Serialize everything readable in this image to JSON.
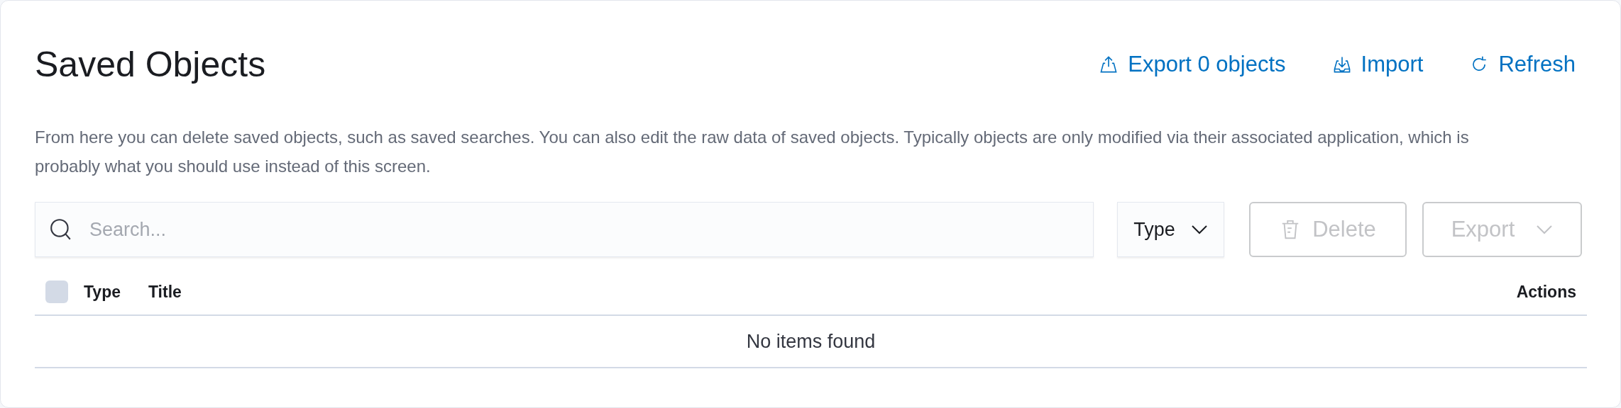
{
  "title": "Saved Objects",
  "header_actions": [
    {
      "kind": "export",
      "label": "Export 0 objects"
    },
    {
      "kind": "import",
      "label": "Import"
    },
    {
      "kind": "refresh",
      "label": "Refresh"
    }
  ],
  "description": "From here you can delete saved objects, such as saved searches. You can also edit the raw data of saved objects. Typically objects are only modified via their associated application, which is probably what you should use instead of this screen.",
  "search": {
    "placeholder": "Search..."
  },
  "type_filter": {
    "label": "Type"
  },
  "delete_button": {
    "label": "Delete",
    "disabled": true
  },
  "export_button": {
    "label": "Export",
    "disabled": true
  },
  "table": {
    "select_all": {
      "checked": false
    },
    "columns": [
      "Type",
      "Title",
      "Actions"
    ],
    "empty_message": "No items found"
  }
}
